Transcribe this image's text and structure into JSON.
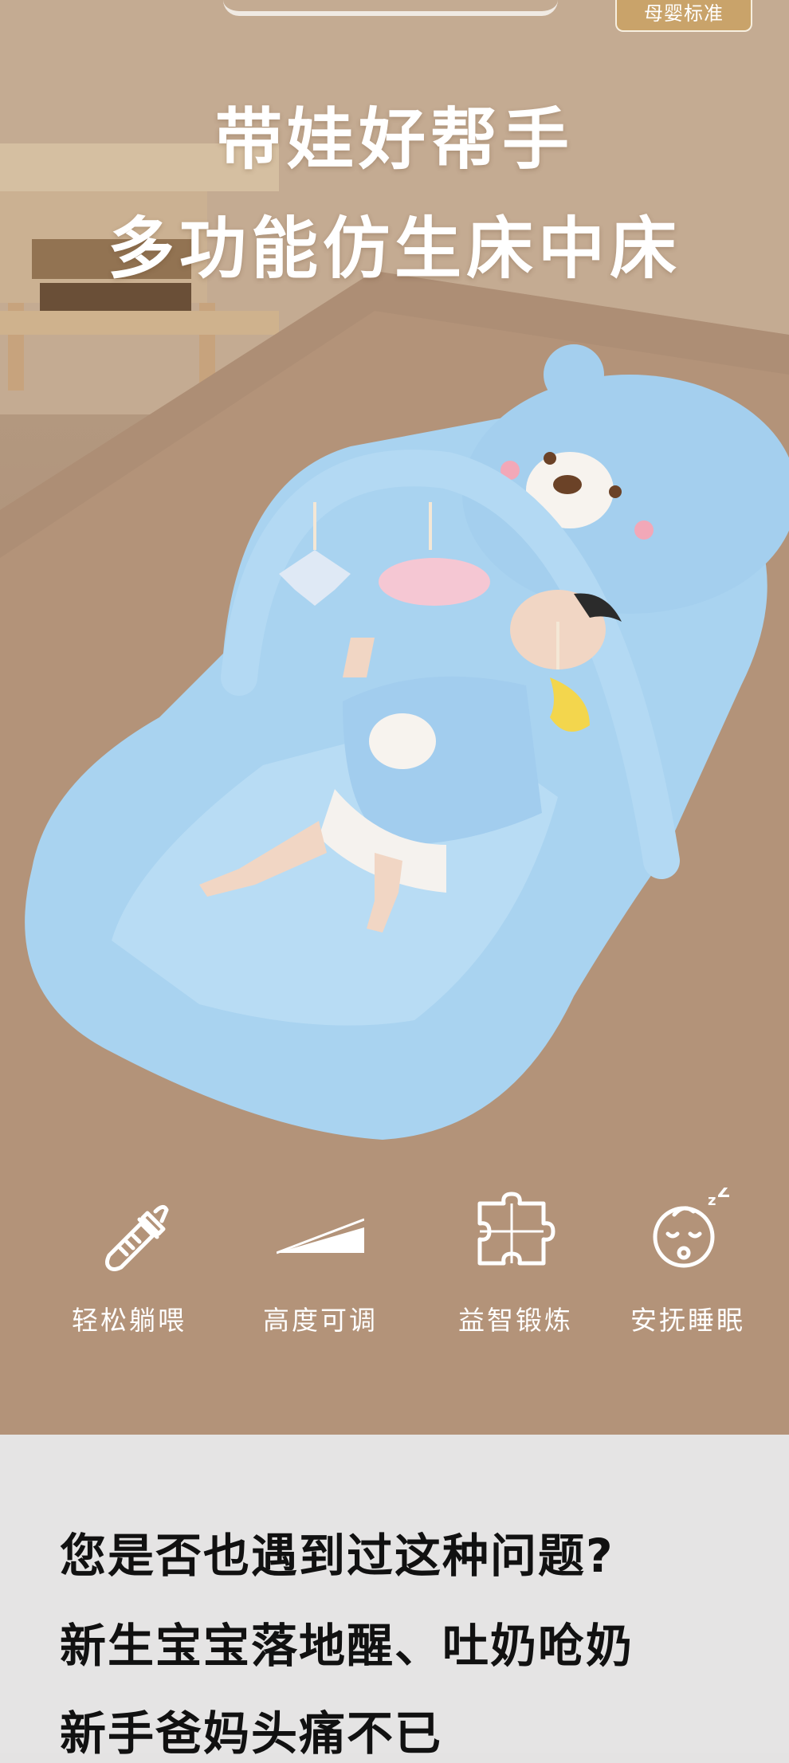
{
  "badge": "母婴标准",
  "headline": {
    "line1": "带娃好帮手",
    "line2": "多功能仿生床中床"
  },
  "features": [
    {
      "icon": "baby-bottle-icon",
      "label": "轻松躺喂"
    },
    {
      "icon": "wedge-slope-icon",
      "label": "高度可调"
    },
    {
      "icon": "puzzle-piece-icon",
      "label": "益智锻炼"
    },
    {
      "icon": "sleeping-baby-icon",
      "label": "安抚睡眠"
    }
  ],
  "question": {
    "line1": "您是否也遇到过这种问题?",
    "line2": "新生宝宝落地醒、吐奶呛奶",
    "line3": "新手爸妈头痛不已"
  },
  "colors": {
    "bed_blue": "#a9d3f0",
    "background_tan": "#b59a81",
    "badge_gold": "#c9a36a",
    "question_bg": "#e5e4e4"
  }
}
